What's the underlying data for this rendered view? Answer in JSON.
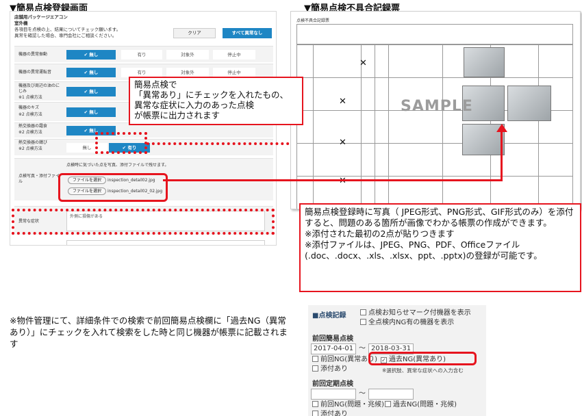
{
  "titles": {
    "left": "▼簡易点検登録画面",
    "right": "▼簡易点検不具合記録票"
  },
  "form": {
    "header_line1": "店舗用パッケージエアコン",
    "header_line2": "室外機",
    "header_line3": "各項目を点検の上、結果についてチェック願います。",
    "header_line4": "異常を確認した場合、専門会社にご相談ください。",
    "clear_label": "クリア",
    "all_none_label": "すべて異常なし",
    "rows": [
      {
        "label": "機器の異常振動",
        "sub": "",
        "selected": "✔ 無し",
        "opts": [
          "有り",
          "対象外",
          "停止中"
        ]
      },
      {
        "label": "機器の異常運転音",
        "sub": "",
        "selected": "✔ 無し",
        "opts": [
          "有り",
          "対象外",
          "停止中"
        ]
      },
      {
        "label": "機器及び周辺の油のにじみ",
        "sub": "※1 点検方法",
        "selected": "✔ 無し",
        "opts": []
      },
      {
        "label": "機器のキズ",
        "sub": "※2 点検方法",
        "selected": "✔ 無し",
        "opts": []
      },
      {
        "label": "熱交換器の霜食",
        "sub": "※2 点検方法",
        "selected": "✔ 無し",
        "opts": []
      },
      {
        "label": "熱交換器の錆び",
        "sub": "※2 点検方法",
        "selected": "✔ 有り",
        "opts": [
          "無し"
        ]
      }
    ],
    "attach_label": "点検写真・添付ファイル",
    "attach_help": "点検時に気づいた点を写真、添付ファイルで残せます。",
    "file_button": "ファイルを選択",
    "files": [
      "inspection_detail02.jpg",
      "inspection_detail02_02.jpg"
    ],
    "abnormal_label": "異常な症状",
    "abnormal_value": "外側に損傷がある"
  },
  "callout1": {
    "line1": "簡易点検で",
    "line2": "「異常あり」にチェックを入れたもの、",
    "line3": "異常な症状に入力のあった点検",
    "line4": "が帳票に出力されます"
  },
  "report": {
    "title": "点検不具合記録票",
    "sample": "SAMPLE",
    "x_mark": "✕"
  },
  "callout2": {
    "line1": "簡易点検登録時に写真（ JPEG形式、PNG形式、GIF形式のみ）を添付すると、問題のある箇所が画像でわかる帳票の作成ができます。",
    "line2": "※添付された最初の2点が貼りつきます",
    "line3": "※添付ファイルは、JPEG、PNG、PDF、Officeファイル(.doc、.docx、.xls、.xlsx、ppt、.pptx)の登録が可能です。"
  },
  "note_bottom": "※物件管理にて、詳細条件での検索で前回簡易点検欄に「過去NG（異常あり）」にチェックを入れて検索をした時と同じ機器が帳票に記載されます",
  "record": {
    "title": "■点検記録",
    "opt1": "点検お知らせマーク付機器を表示",
    "opt2": "全点検内NG有の機器を表示",
    "prev_simple": "前回簡易点検",
    "date_from": "2017-04-01",
    "date_to": "2018-03-31",
    "tilde": "〜",
    "prev_ng": "前回NG(異常あり)",
    "past_ng": "過去NG(異常あり)",
    "attach": "添付あり",
    "note": "※選択肢、異常な症状への入力含む",
    "prev_periodic": "前回定期点検",
    "prev_ng2": "前回NG(問題・兆候)",
    "past_ng2": "過去NG(問題・兆候)",
    "attach2": "添付あり"
  }
}
